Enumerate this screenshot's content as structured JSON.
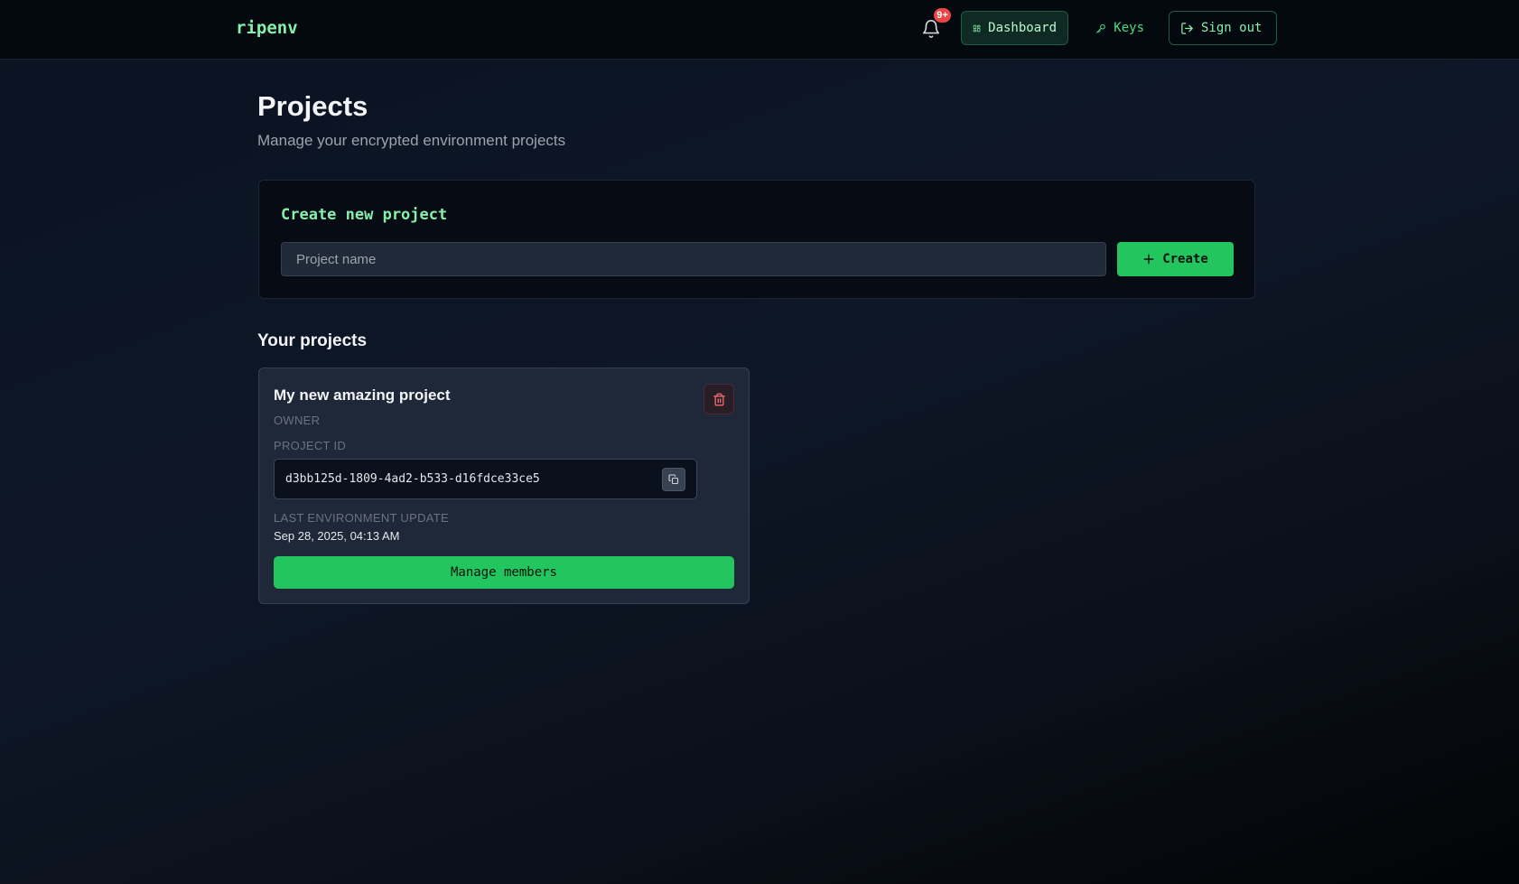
{
  "header": {
    "brand": "ripenv",
    "notifications_badge": "9+",
    "nav": {
      "dashboard_label": "Dashboard",
      "keys_label": "Keys",
      "signout_label": "Sign out"
    }
  },
  "page": {
    "title": "Projects",
    "subtitle": "Manage your encrypted environment projects"
  },
  "create_card": {
    "title": "Create new project",
    "input_placeholder": "Project name",
    "input_value": "",
    "create_label": "Create"
  },
  "projects_section": {
    "title": "Your projects",
    "projects": [
      {
        "name": "My new amazing project",
        "role": "OWNER",
        "id_label": "PROJECT ID",
        "id": "d3bb125d-1809-4ad2-b533-d16fdce33ce5",
        "update_label": "LAST ENVIRONMENT UPDATE",
        "updated_at": "Sep 28, 2025, 04:13 AM",
        "manage_label": "Manage members"
      }
    ]
  },
  "colors": {
    "accent": "#22c55e",
    "accent_text": "#86efac",
    "danger": "#ef4444",
    "background": "#0e1727"
  },
  "icons": {
    "notifications": "bell-icon",
    "dashboard": "grid-icon",
    "keys": "key-icon",
    "signout": "logout-icon",
    "create": "plus-icon",
    "delete": "trash-icon",
    "copy": "copy-icon"
  }
}
